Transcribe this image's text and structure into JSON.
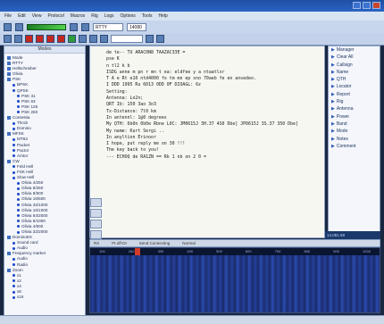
{
  "window": {
    "title": "",
    "controls": [
      "minimize",
      "maximize",
      "close"
    ]
  },
  "menu": [
    "File",
    "Edit",
    "View",
    "Protocol",
    "Macros",
    "Rig",
    "Logs",
    "Options",
    "Tools",
    "Help"
  ],
  "toolbar": {
    "mode_field": "RTTY",
    "freq_field": "14080"
  },
  "left_panel": {
    "header": "Modes",
    "tree": [
      {
        "label": "Mode",
        "level": 1,
        "kind": "sq"
      },
      {
        "label": "RTTY",
        "level": 1,
        "kind": "sq"
      },
      {
        "label": "Hellschreiber",
        "level": 1,
        "kind": "sq"
      },
      {
        "label": "Olivia",
        "level": 1,
        "kind": "sq"
      },
      {
        "label": "PSK",
        "level": 1,
        "kind": "sq"
      },
      {
        "label": "BPSK",
        "level": 2,
        "kind": "dot"
      },
      {
        "label": "QPSK",
        "level": 2,
        "kind": "dot"
      },
      {
        "label": "PSK 31",
        "level": 3,
        "kind": "dot"
      },
      {
        "label": "PSK 63",
        "level": 3,
        "kind": "dot"
      },
      {
        "label": "PSK 125",
        "level": 3,
        "kind": "dot"
      },
      {
        "label": "PSK 250",
        "level": 3,
        "kind": "dot"
      },
      {
        "label": "Contestia",
        "level": 1,
        "kind": "sq"
      },
      {
        "label": "Throb",
        "level": 2,
        "kind": "dot"
      },
      {
        "label": "Domino",
        "level": 2,
        "kind": "dot"
      },
      {
        "label": "MFSK",
        "level": 1,
        "kind": "sq"
      },
      {
        "label": "MT63",
        "level": 2,
        "kind": "dot"
      },
      {
        "label": "Packet",
        "level": 2,
        "kind": "dot"
      },
      {
        "label": "Pactor",
        "level": 2,
        "kind": "dot"
      },
      {
        "label": "Amtor",
        "level": 2,
        "kind": "dot"
      },
      {
        "label": "CW",
        "level": 1,
        "kind": "sq"
      },
      {
        "label": "Feld Hell",
        "level": 2,
        "kind": "dot"
      },
      {
        "label": "FSK Hell",
        "level": 2,
        "kind": "dot"
      },
      {
        "label": "Slow Hell",
        "level": 2,
        "kind": "dot"
      },
      {
        "label": "Olivia 4/250",
        "level": 3,
        "kind": "dot"
      },
      {
        "label": "Olivia 8/250",
        "level": 3,
        "kind": "dot"
      },
      {
        "label": "Olivia 8/500",
        "level": 3,
        "kind": "dot"
      },
      {
        "label": "Olivia 16/500",
        "level": 3,
        "kind": "dot"
      },
      {
        "label": "Olivia 32/1000",
        "level": 3,
        "kind": "dot"
      },
      {
        "label": "Olivia 16/1000",
        "level": 3,
        "kind": "dot"
      },
      {
        "label": "Olivia 64/2000",
        "level": 3,
        "kind": "dot"
      },
      {
        "label": "Olivia 8/1000",
        "level": 3,
        "kind": "dot"
      },
      {
        "label": "Olivia 4/500",
        "level": 3,
        "kind": "dot"
      },
      {
        "label": "Olivia 32/2000",
        "level": 3,
        "kind": "dot"
      },
      {
        "label": "DominoEX",
        "level": 1,
        "kind": "sq"
      },
      {
        "label": "Sound card",
        "level": 2,
        "kind": "dot"
      },
      {
        "label": "Audio",
        "level": 2,
        "kind": "dot"
      },
      {
        "label": "Frequency marker",
        "level": 1,
        "kind": "sq"
      },
      {
        "label": "Audio",
        "level": 2,
        "kind": "dot"
      },
      {
        "label": "Radio",
        "level": 2,
        "kind": "dot"
      },
      {
        "label": "Zoom",
        "level": 1,
        "kind": "sq"
      },
      {
        "label": "x1",
        "level": 2,
        "kind": "dot"
      },
      {
        "label": "x2",
        "level": 2,
        "kind": "dot"
      },
      {
        "label": "x4",
        "level": 2,
        "kind": "dot"
      },
      {
        "label": "x8",
        "level": 2,
        "kind": "dot"
      },
      {
        "label": "x16",
        "level": 2,
        "kind": "dot"
      }
    ]
  },
  "text_pane": {
    "lines": [
      "de te-- TU ARAC0N8 TAAZAC33E =",
      "pse K",
      "n tl2 k b",
      "ISDG anne m pn r mn t ea: eldfee y a ntaatlxr",
      "T A e Rt e10 ntd4000 fo tm mn ep sno 70aeb fe en ansedeo.",
      "I DDD 1995 Ru 6013 0DD 0F DIOAGL: 6z",
      "Setting:",
      "Antenna: Lo2n;",
      "QRT Ib: 150 3ao 3o3",
      "Tx-Distance: 7l0 km",
      "In antennl: 1@0 degrees",
      "My QTH: 6b0n 0b0e Rbne L0C: JM0615J 3H.37 4S0 Dbe] JP0615J 3S.37 350 Dbe]",
      "My name: Kurt Sergi ..",
      "In anyltion Erinoor",
      "I hope, put reply me on 30 !!!",
      "The key back to you!",
      "--- ECHOQ de RA1ZN == Rk 1 nb on 2 0 ="
    ]
  },
  "right_panel": {
    "macros": [
      "Manager",
      "Clear All",
      "Callsign",
      "Name",
      "QTH",
      "Locator",
      "Report",
      "Rig",
      "Antenna",
      "Power",
      "Band",
      "Mode",
      "Notes",
      "Comment"
    ]
  },
  "rx_box": "14.081.59",
  "status1": [
    "RX",
    "Pr.off-DI",
    "Send Connecting",
    "Normal"
  ],
  "waterfall": {
    "scale": [
      "100",
      "200",
      "300",
      "400",
      "500",
      "600",
      "700",
      "800",
      "900",
      "1000"
    ]
  },
  "status2": {
    "left": "",
    "right": ""
  },
  "colors": {
    "title": "#2a64c4",
    "waterfall": "#26409a",
    "tx_button": "#c4271f",
    "level_meter": "#54d44f"
  }
}
